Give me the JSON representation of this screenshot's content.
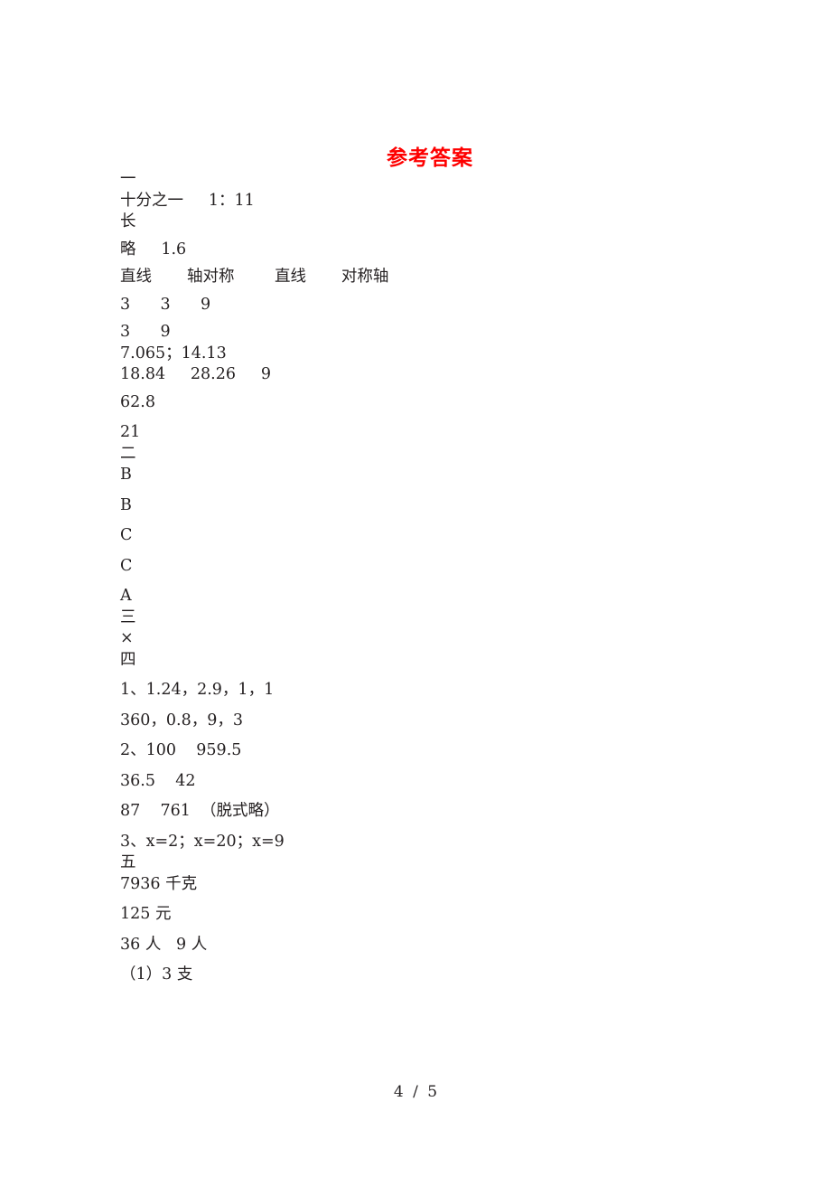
{
  "document": {
    "title": "参考答案",
    "title_color": "#fe0000",
    "text_color": "#231f20",
    "background_color": "#ffffff"
  },
  "lines": [
    {
      "text": "一",
      "gap": "first"
    },
    {
      "text": "十分之一     1：11",
      "gap": "tight"
    },
    {
      "text": "长",
      "gap": "tight"
    },
    {
      "text": "略     1.6",
      "gap": "normal"
    },
    {
      "text": "直线       轴对称        直线       对称轴",
      "gap": "normal"
    },
    {
      "text": "3      3      9",
      "gap": "normal"
    },
    {
      "text": "3      9",
      "gap": "normal"
    },
    {
      "text": "7.065；14.13",
      "gap": "tight"
    },
    {
      "text": "18.84     28.26     9",
      "gap": "tight"
    },
    {
      "text": "62.8",
      "gap": "normal"
    },
    {
      "text": "21",
      "gap": "wide"
    },
    {
      "text": "二",
      "gap": "tight"
    },
    {
      "text": "B",
      "gap": "tight"
    },
    {
      "text": "B",
      "gap": "wide"
    },
    {
      "text": "C",
      "gap": "wide"
    },
    {
      "text": "C",
      "gap": "wide"
    },
    {
      "text": "A",
      "gap": "wide"
    },
    {
      "text": "三",
      "gap": "tight"
    },
    {
      "text": "×",
      "gap": "tight"
    },
    {
      "text": "四",
      "gap": "tight"
    },
    {
      "text": "1、1.24，2.9，1，1",
      "gap": "wide"
    },
    {
      "text": "360，0.8，9，3",
      "gap": "wide"
    },
    {
      "text": "2、100    959.5",
      "gap": "wide"
    },
    {
      "text": "36.5    42",
      "gap": "wide"
    },
    {
      "text": "87    761  （脱式略）",
      "gap": "wide"
    },
    {
      "text": "3、x=2；x=20；x=9",
      "gap": "wide"
    },
    {
      "text": "五",
      "gap": "tight"
    },
    {
      "text": "7936 千克",
      "gap": "tight"
    },
    {
      "text": "125 元",
      "gap": "wide"
    },
    {
      "text": "36 人   9 人",
      "gap": "wide"
    },
    {
      "text": "（1）3 支",
      "gap": "wide"
    }
  ],
  "footer": {
    "current_page": "4",
    "separator": "/",
    "total_pages": "5"
  }
}
